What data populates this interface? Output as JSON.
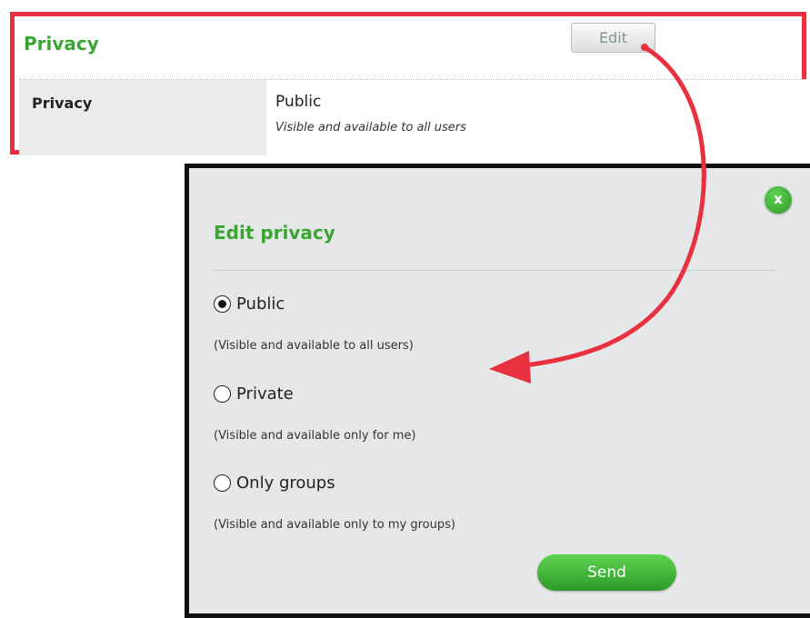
{
  "section": {
    "title": "Privacy",
    "edit_label": "Edit",
    "row": {
      "label": "Privacy",
      "value": "Public",
      "description": "Visible and available to all users"
    }
  },
  "modal": {
    "close_label": "x",
    "title": "Edit privacy",
    "options": [
      {
        "label": "Public",
        "description": "(Visible and available to all users)",
        "checked": true
      },
      {
        "label": "Private",
        "description": "(Visible and available only for me)",
        "checked": false
      },
      {
        "label": "Only groups",
        "description": "(Visible and available only to my groups)",
        "checked": false
      }
    ],
    "send_label": "Send"
  },
  "colors": {
    "highlight_border": "#e8303f",
    "accent_green": "#3aa632",
    "arrow": "#e8303f"
  },
  "icons": {
    "radio": "radio-button-icon",
    "arrow": "curved-arrow-icon",
    "close": "close-icon"
  }
}
